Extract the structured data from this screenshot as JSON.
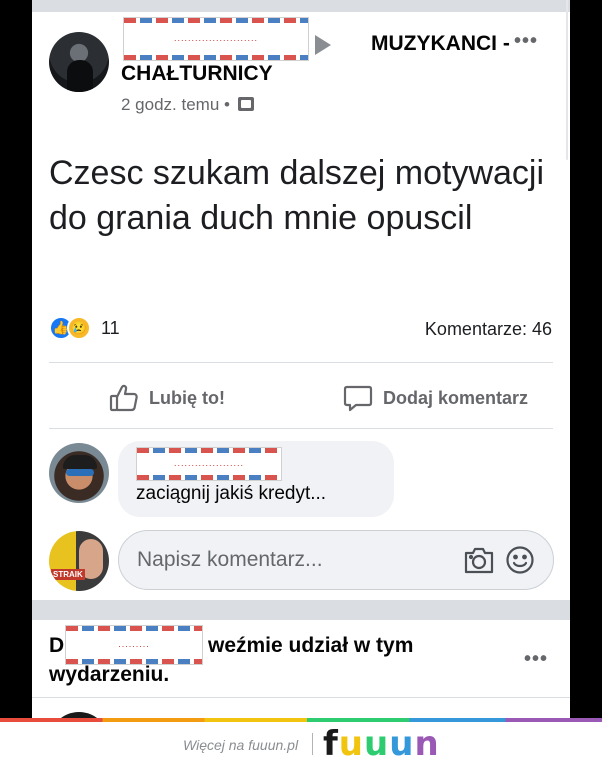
{
  "post": {
    "group_name_line1": "MUZYKANCI -",
    "group_name_line2": "CHAŁTURNICY",
    "time": "2 godz. temu",
    "time_separator": "•",
    "text": "Czesc szukam dalszej motywacji do grania duch mnie opuscil",
    "more_label": "•••",
    "reactions_count": "11",
    "comments_count": "Komentarze: 46",
    "like_label": "Lubię to!",
    "comment_label": "Dodaj komentarz"
  },
  "comment": {
    "text": "zaciągnij jakiś kredyt..."
  },
  "composer": {
    "placeholder": "Napisz komentarz..."
  },
  "avatar_c2": {
    "tag": "STRAIK"
  },
  "suggestion": {
    "initial": "D",
    "text_line1": "weźmie udział w tym",
    "text_line2": "wydarzeniu.",
    "more_label": "•••"
  },
  "footer": {
    "text": "Więcej na fuuun.pl",
    "brand": "fuuun"
  },
  "colors": {
    "like_blue": "#1877f2",
    "sad_yellow": "#f7b928",
    "text_secondary": "#65676b",
    "bubble_bg": "#f0f2f5",
    "brand_f": "#1a1a1a",
    "brand_u1": "#f1c40f",
    "brand_u2": "#2ecc71",
    "brand_u3": "#3498db",
    "brand_n": "#9b59b6"
  }
}
